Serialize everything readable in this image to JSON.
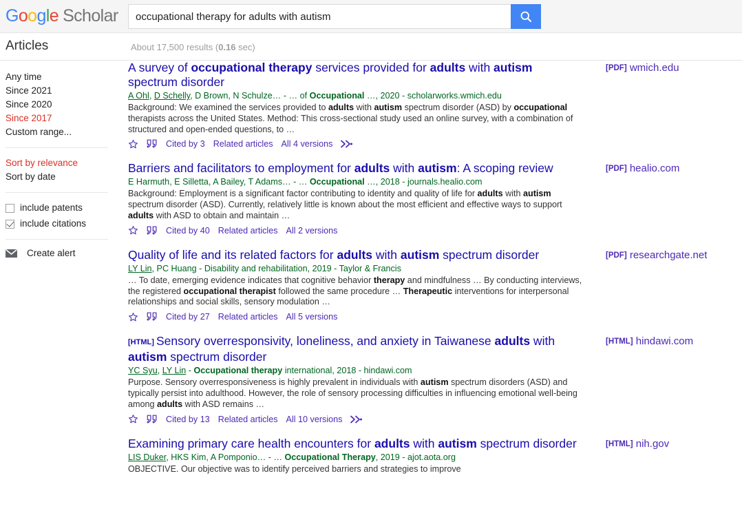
{
  "header": {
    "logo_word1_letters": [
      "G",
      "o",
      "o",
      "g",
      "l",
      "e"
    ],
    "logo_word2": "Scholar",
    "search_value": "occupational therapy for adults with autism",
    "search_placeholder": "",
    "search_button_icon": "search-icon",
    "accent_blue": "#4285f4"
  },
  "subbar": {
    "title": "Articles",
    "results_prefix": "About 17,500 results (",
    "results_time": "0.16",
    "results_suffix": " sec)"
  },
  "sidebar": {
    "date_filters": [
      {
        "label": "Any time",
        "active": false
      },
      {
        "label": "Since 2021",
        "active": false
      },
      {
        "label": "Since 2020",
        "active": false
      },
      {
        "label": "Since 2017",
        "active": true
      },
      {
        "label": "Custom range...",
        "active": false
      }
    ],
    "sort_options": [
      {
        "label": "Sort by relevance",
        "active": true
      },
      {
        "label": "Sort by date",
        "active": false
      }
    ],
    "checkboxes": [
      {
        "label": "include patents",
        "checked": false
      },
      {
        "label": "include citations",
        "checked": true
      }
    ],
    "create_alert": "Create alert",
    "active_color": "#d93025"
  },
  "results": [
    {
      "doctag": "",
      "title_parts": [
        {
          "t": "A survey of ",
          "b": false
        },
        {
          "t": "occupational therapy",
          "b": true
        },
        {
          "t": " services provided for ",
          "b": false
        },
        {
          "t": "adults",
          "b": true
        },
        {
          "t": " with ",
          "b": false
        },
        {
          "t": "autism",
          "b": true
        },
        {
          "t": " spectrum disorder",
          "b": false
        }
      ],
      "meta_parts": [
        {
          "t": "A Ohl",
          "link": true,
          "b": false
        },
        {
          "t": ", ",
          "link": false,
          "b": false
        },
        {
          "t": "D Schelly",
          "link": true,
          "b": false
        },
        {
          "t": ", D Brown, N Schulze… - … of ",
          "link": false,
          "b": false
        },
        {
          "t": "Occupational",
          "link": false,
          "b": true
        },
        {
          "t": " …, 2020 - scholarworks.wmich.edu",
          "link": false,
          "b": false
        }
      ],
      "snippet_parts": [
        {
          "t": "Background: We examined the services provided to ",
          "b": false
        },
        {
          "t": "adults",
          "b": true
        },
        {
          "t": " with ",
          "b": false
        },
        {
          "t": "autism",
          "b": true
        },
        {
          "t": " spectrum disorder (ASD) by ",
          "b": false
        },
        {
          "t": "occupational",
          "b": true
        },
        {
          "t": " therapists across the United States. Method: This cross-sectional study used an online survey, with a combination of structured and open-ended questions, to …",
          "b": false
        }
      ],
      "actions": {
        "cited_by": "Cited by 3",
        "related": "Related articles",
        "versions": "All 4 versions",
        "has_more": true
      },
      "source": {
        "tag": "[PDF]",
        "domain": "wmich.edu"
      }
    },
    {
      "doctag": "",
      "title_parts": [
        {
          "t": "Barriers and facilitators to employment for ",
          "b": false
        },
        {
          "t": "adults",
          "b": true
        },
        {
          "t": " with ",
          "b": false
        },
        {
          "t": "autism",
          "b": true
        },
        {
          "t": ": A scoping review",
          "b": false
        }
      ],
      "meta_parts": [
        {
          "t": "E Harmuth, E Silletta, A Bailey, T Adams… - … ",
          "link": false,
          "b": false
        },
        {
          "t": "Occupational",
          "link": false,
          "b": true
        },
        {
          "t": " …, 2018 - journals.healio.com",
          "link": false,
          "b": false
        }
      ],
      "snippet_parts": [
        {
          "t": "Background: Employment is a significant factor contributing to identity and quality of life for ",
          "b": false
        },
        {
          "t": "adults",
          "b": true
        },
        {
          "t": " with ",
          "b": false
        },
        {
          "t": "autism",
          "b": true
        },
        {
          "t": " spectrum disorder (ASD). Currently, relatively little is known about the most efficient and effective ways to support ",
          "b": false
        },
        {
          "t": "adults",
          "b": true
        },
        {
          "t": " with ASD to obtain and maintain …",
          "b": false
        }
      ],
      "actions": {
        "cited_by": "Cited by 40",
        "related": "Related articles",
        "versions": "All 2 versions",
        "has_more": false
      },
      "source": {
        "tag": "[PDF]",
        "domain": "healio.com"
      }
    },
    {
      "doctag": "",
      "title_parts": [
        {
          "t": "Quality of life and its related factors for ",
          "b": false
        },
        {
          "t": "adults",
          "b": true
        },
        {
          "t": " with ",
          "b": false
        },
        {
          "t": "autism",
          "b": true
        },
        {
          "t": " spectrum disorder",
          "b": false
        }
      ],
      "meta_parts": [
        {
          "t": "LY Lin",
          "link": true,
          "b": false
        },
        {
          "t": ", PC Huang - Disability and rehabilitation, 2019 - Taylor & Francis",
          "link": false,
          "b": false
        }
      ],
      "snippet_parts": [
        {
          "t": "… To date, emerging evidence indicates that cognitive behavior ",
          "b": false
        },
        {
          "t": "therapy",
          "b": true
        },
        {
          "t": " and mindfulness … By conducting interviews, the registered ",
          "b": false
        },
        {
          "t": "occupational therapist",
          "b": true
        },
        {
          "t": " followed the same procedure … ",
          "b": false
        },
        {
          "t": "Therapeutic",
          "b": true
        },
        {
          "t": " interventions for interpersonal relationships and social skills, sensory modulation …",
          "b": false
        }
      ],
      "actions": {
        "cited_by": "Cited by 27",
        "related": "Related articles",
        "versions": "All 5 versions",
        "has_more": false
      },
      "source": {
        "tag": "[PDF]",
        "domain": "researchgate.net"
      }
    },
    {
      "doctag": "[HTML]",
      "title_parts": [
        {
          "t": "Sensory overresponsivity, loneliness, and anxiety in Taiwanese ",
          "b": false
        },
        {
          "t": "adults",
          "b": true
        },
        {
          "t": " with ",
          "b": false
        },
        {
          "t": "autism",
          "b": true
        },
        {
          "t": " spectrum disorder",
          "b": false
        }
      ],
      "meta_parts": [
        {
          "t": "YC Syu",
          "link": true,
          "b": false
        },
        {
          "t": ", ",
          "link": false,
          "b": false
        },
        {
          "t": "LY Lin",
          "link": true,
          "b": false
        },
        {
          "t": " - ",
          "link": false,
          "b": false
        },
        {
          "t": "Occupational therapy",
          "link": false,
          "b": true
        },
        {
          "t": " international, 2018 - hindawi.com",
          "link": false,
          "b": false
        }
      ],
      "snippet_parts": [
        {
          "t": "Purpose. Sensory overresponsiveness is highly prevalent in individuals with ",
          "b": false
        },
        {
          "t": "autism",
          "b": true
        },
        {
          "t": " spectrum disorders (ASD) and typically persist into adulthood. However, the role of sensory processing difficulties in influencing emotional well-being among ",
          "b": false
        },
        {
          "t": "adults",
          "b": true
        },
        {
          "t": " with ASD remains …",
          "b": false
        }
      ],
      "actions": {
        "cited_by": "Cited by 13",
        "related": "Related articles",
        "versions": "All 10 versions",
        "has_more": true
      },
      "source": {
        "tag": "[HTML]",
        "domain": "hindawi.com"
      }
    },
    {
      "doctag": "",
      "title_parts": [
        {
          "t": "Examining primary care health encounters for ",
          "b": false
        },
        {
          "t": "adults",
          "b": true
        },
        {
          "t": " with ",
          "b": false
        },
        {
          "t": "autism",
          "b": true
        },
        {
          "t": " spectrum disorder",
          "b": false
        }
      ],
      "meta_parts": [
        {
          "t": "LIS Duker",
          "link": true,
          "b": false
        },
        {
          "t": ", HKS Kim, A Pomponio… - … ",
          "link": false,
          "b": false
        },
        {
          "t": "Occupational Therapy",
          "link": false,
          "b": true
        },
        {
          "t": ", 2019 - ajot.aota.org",
          "link": false,
          "b": false
        }
      ],
      "snippet_parts": [
        {
          "t": "OBJECTIVE. Our objective was to identify perceived barriers and strategies to improve",
          "b": false
        }
      ],
      "actions": null,
      "source": {
        "tag": "[HTML]",
        "domain": "nih.gov"
      }
    }
  ],
  "colors": {
    "title_link": "#1a0dab",
    "meta_green": "#006621",
    "action_purple": "#4d2ab5",
    "source_purple": "#4d2ab5"
  }
}
